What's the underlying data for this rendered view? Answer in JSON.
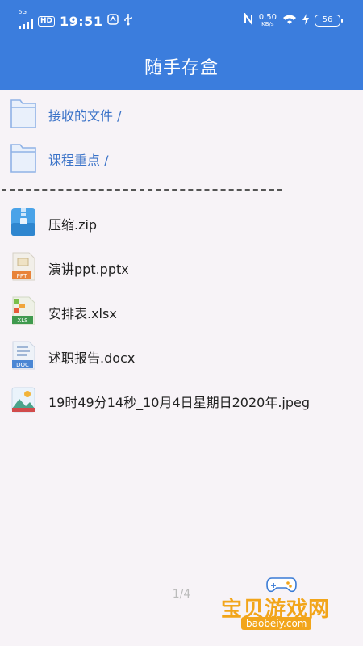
{
  "status_bar": {
    "network": "5G",
    "hd": "HD",
    "time": "19:51",
    "speed_value": "0.50",
    "speed_unit": "KB/s",
    "battery": "56"
  },
  "header": {
    "title": "随手存盒"
  },
  "folders": [
    {
      "label": "接收的文件 /",
      "icon": "folder-icon"
    },
    {
      "label": "课程重点 /",
      "icon": "folder-icon"
    }
  ],
  "files": [
    {
      "label": "压缩.zip",
      "icon": "zip-icon"
    },
    {
      "label": "演讲ppt.pptx",
      "icon": "ppt-icon"
    },
    {
      "label": "安排表.xlsx",
      "icon": "xls-icon"
    },
    {
      "label": "述职报告.docx",
      "icon": "doc-icon"
    },
    {
      "label": "19时49分14秒_10月4日星期日2020年.jpeg",
      "icon": "image-icon"
    }
  ],
  "icon_text": {
    "ppt": "PPT",
    "xls": "XLS",
    "doc": "DOC"
  },
  "pager": "1/4",
  "watermark": {
    "text": "宝贝游戏网",
    "url": "baobeiy.com"
  },
  "colors": {
    "header": "#3b7ddd",
    "folder_text": "#3b73c8",
    "background": "#f7f3f7"
  }
}
